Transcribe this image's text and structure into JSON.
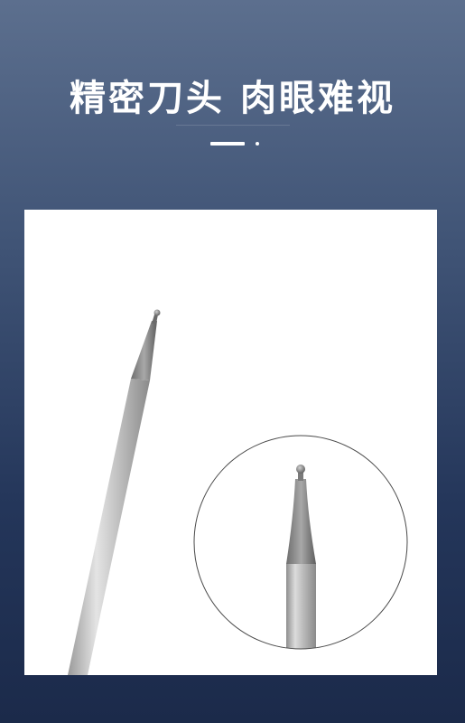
{
  "headline": "精密刀头 肉眼难视",
  "colors": {
    "background_top": "#5c6f8e",
    "background_bottom": "#1b2a4a",
    "card": "#ffffff",
    "title": "#ffffff"
  }
}
